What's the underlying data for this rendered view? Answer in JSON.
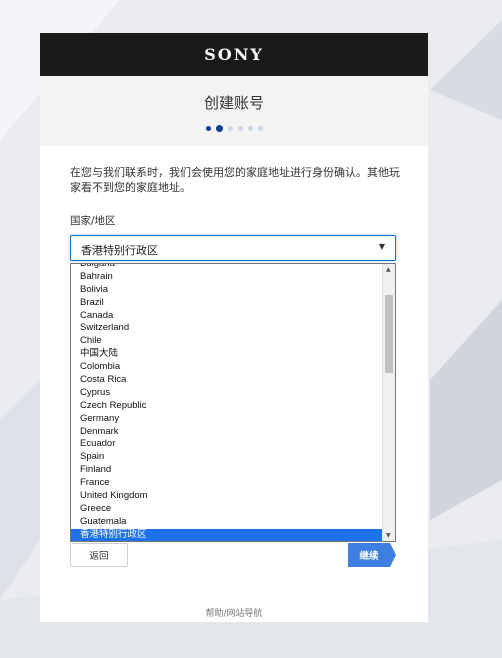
{
  "brand": "SONY",
  "page": {
    "title": "创建账号",
    "progress": {
      "total_steps": 6,
      "current_step": 2
    },
    "intro": "在您与我们联系时，我们会使用您的家庭地址进行身份确认。其他玩家看不到您的家庭地址。",
    "country_label": "国家/地区",
    "country_select": {
      "value": "香港特别行政区"
    },
    "country_options": [
      "Bulgaria",
      "Bahrain",
      "Bolivia",
      "Brazil",
      "Canada",
      "Switzerland",
      "Chile",
      "中国大陆",
      "Colombia",
      "Costa Rica",
      "Cyprus",
      "Czech Republic",
      "Germany",
      "Denmark",
      "Ecuador",
      "Spain",
      "Finland",
      "France",
      "United Kingdom",
      "Greece",
      "Guatemala",
      "香港特别行政区"
    ],
    "selected_option_index": 21,
    "back_label": "返回",
    "next_label": "继续",
    "footer_link": "帮助/网站导航"
  },
  "colors": {
    "brand_bar": "#1a1a1a",
    "accent": "#0d6fd1",
    "selected_option": "#1e73e8",
    "next_button": "#3c7fe0"
  }
}
